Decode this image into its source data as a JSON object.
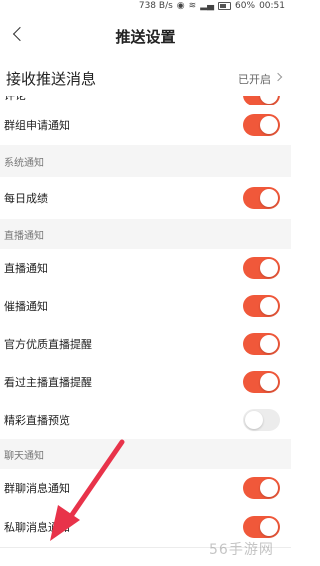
{
  "status_bar": {
    "speed": "738 B/s",
    "battery": "60%",
    "time": "00:51"
  },
  "nav": {
    "title": "推送设置"
  },
  "master": {
    "label": "接收推送消息",
    "state": "已开启"
  },
  "rows": [
    {
      "type": "row",
      "label": "评论",
      "toggle": true
    },
    {
      "type": "row",
      "label": "群组申请通知",
      "toggle": true
    },
    {
      "type": "section",
      "label": "系统通知"
    },
    {
      "type": "row",
      "label": "每日成绩",
      "toggle": true
    },
    {
      "type": "section",
      "label": "直播通知"
    },
    {
      "type": "row",
      "label": "直播通知",
      "toggle": true
    },
    {
      "type": "row",
      "label": "催播通知",
      "toggle": true
    },
    {
      "type": "row",
      "label": "官方优质直播提醒",
      "toggle": true
    },
    {
      "type": "row",
      "label": "看过主播直播提醒",
      "toggle": true
    },
    {
      "type": "row",
      "label": "精彩直播预览",
      "toggle": false
    },
    {
      "type": "section",
      "label": "聊天通知"
    },
    {
      "type": "row",
      "label": "群聊消息通知",
      "toggle": true
    },
    {
      "type": "row",
      "label": "私聊消息通知",
      "toggle": true
    }
  ],
  "watermark": "56手游网",
  "colors": {
    "accent": "#f0583a",
    "arrow": "#e8334a"
  }
}
